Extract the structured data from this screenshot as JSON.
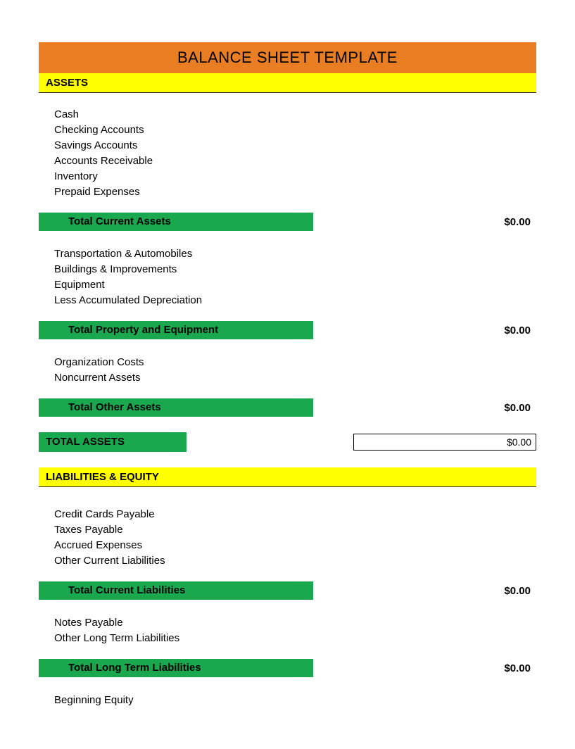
{
  "title": "BALANCE SHEET TEMPLATE",
  "sections": {
    "assets": {
      "header": "ASSETS",
      "group1": {
        "items": [
          "Cash",
          "Checking Accounts",
          "Savings Accounts",
          "Accounts Receivable",
          "Inventory",
          "Prepaid Expenses"
        ],
        "total_label": "Total Current Assets",
        "total_value": "$0.00"
      },
      "group2": {
        "items": [
          "Transportation & Automobiles",
          "Buildings & Improvements",
          "Equipment",
          "Less Accumulated Depreciation"
        ],
        "total_label": "Total Property and Equipment",
        "total_value": "$0.00"
      },
      "group3": {
        "items": [
          "Organization Costs",
          "Noncurrent Assets"
        ],
        "total_label": "Total Other Assets",
        "total_value": "$0.00"
      },
      "grand_label": "TOTAL ASSETS",
      "grand_value": "$0.00"
    },
    "liabilities": {
      "header": "LIABILITIES & EQUITY",
      "group1": {
        "items": [
          "Credit Cards Payable",
          "Taxes Payable",
          "Accrued Expenses",
          "Other Current Liabilities"
        ],
        "total_label": "Total Current Liabilities",
        "total_value": "$0.00"
      },
      "group2": {
        "items": [
          "Notes Payable",
          "Other Long Term Liabilities"
        ],
        "total_label": "Total Long Term Liabilities",
        "total_value": "$0.00"
      },
      "group3": {
        "items": [
          "Beginning Equity"
        ]
      }
    }
  }
}
